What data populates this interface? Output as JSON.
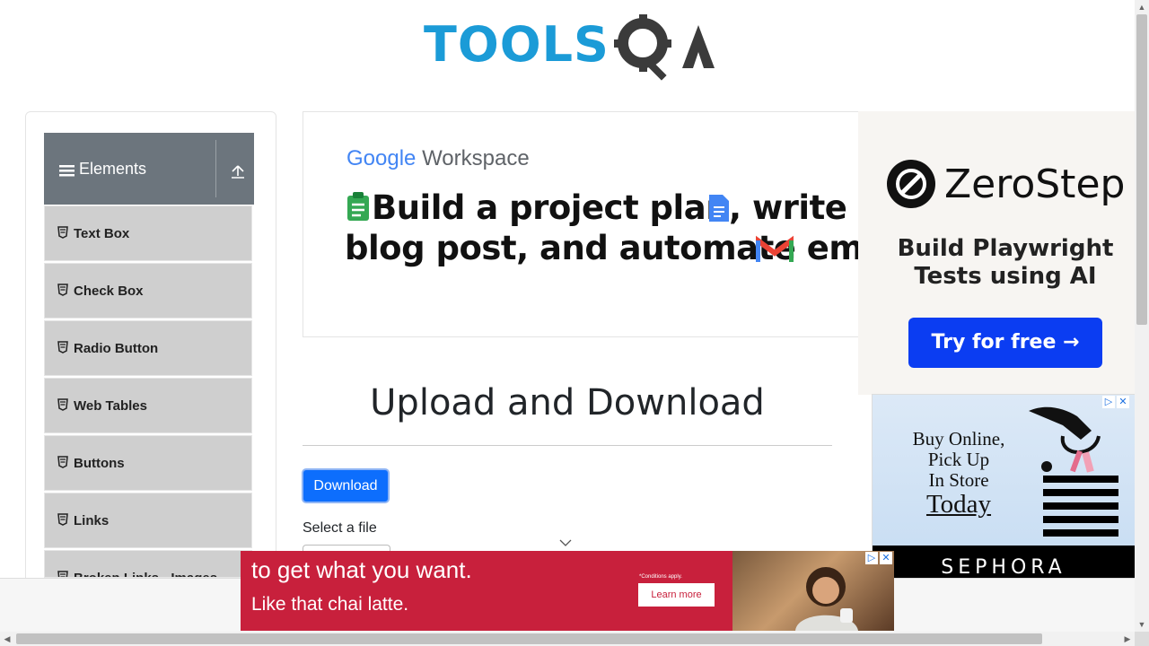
{
  "header": {
    "logo_tools": "TOOLS",
    "logo_qa": "QA"
  },
  "sidebar": {
    "group_title": "Elements",
    "items": [
      {
        "label": "Text Box"
      },
      {
        "label": "Check Box"
      },
      {
        "label": "Radio Button"
      },
      {
        "label": "Web Tables"
      },
      {
        "label": "Buttons"
      },
      {
        "label": "Links"
      },
      {
        "label": "Broken Links - Images"
      }
    ]
  },
  "main_ad": {
    "brand_google": "Google",
    "brand_workspace": "Workspace",
    "headline_line1": "Build a project plan, write a",
    "headline_line2": "blog post, and automate email"
  },
  "main": {
    "page_title": "Upload and Download",
    "download_label": "Download",
    "select_file_label": "Select a file"
  },
  "right_ads": {
    "zerostep": {
      "name": "ZeroStep",
      "tagline": "Build Playwright Tests using AI",
      "cta": "Try for free →"
    },
    "sephora": {
      "line1": "Buy Online,",
      "line2": "Pick Up",
      "line3": "In Store",
      "line4": "Today",
      "brand": "SEPHORA"
    }
  },
  "bottom_ad": {
    "line1": "to get what you want.",
    "line2": "Like that chai latte.",
    "conditions": "*Conditions apply.",
    "cta": "Learn more"
  },
  "colors": {
    "accent": "#0d6efd",
    "sidebar_header": "#6c757d",
    "brand_blue": "#1b9bd7",
    "ad_red": "#c8203c"
  }
}
